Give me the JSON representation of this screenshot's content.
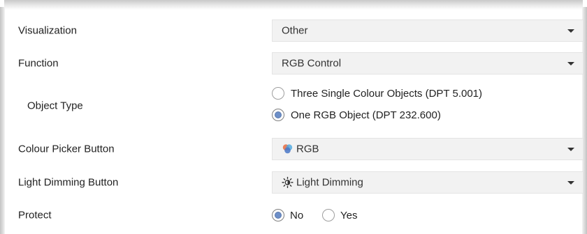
{
  "rows": {
    "visualization": {
      "label": "Visualization",
      "value": "Other"
    },
    "function": {
      "label": "Function",
      "value": "RGB Control"
    },
    "object_type": {
      "label": "Object Type",
      "options": [
        {
          "label": "Three Single Colour Objects (DPT 5.001)",
          "selected": false
        },
        {
          "label": "One RGB Object (DPT 232.600)",
          "selected": true
        }
      ]
    },
    "colour_picker": {
      "label": "Colour Picker Button",
      "value": "RGB",
      "icon": "rgb-circles-icon"
    },
    "light_dimming": {
      "label": "Light Dimming Button",
      "value": "Light Dimming",
      "icon": "sun-icon"
    },
    "protect": {
      "label": "Protect",
      "options": [
        {
          "label": "No",
          "selected": true
        },
        {
          "label": "Yes",
          "selected": false
        }
      ]
    }
  },
  "colors": {
    "dropdown_bg": "#f2f2f2",
    "radio_selected": "#6d8fc8",
    "text": "#222222"
  }
}
